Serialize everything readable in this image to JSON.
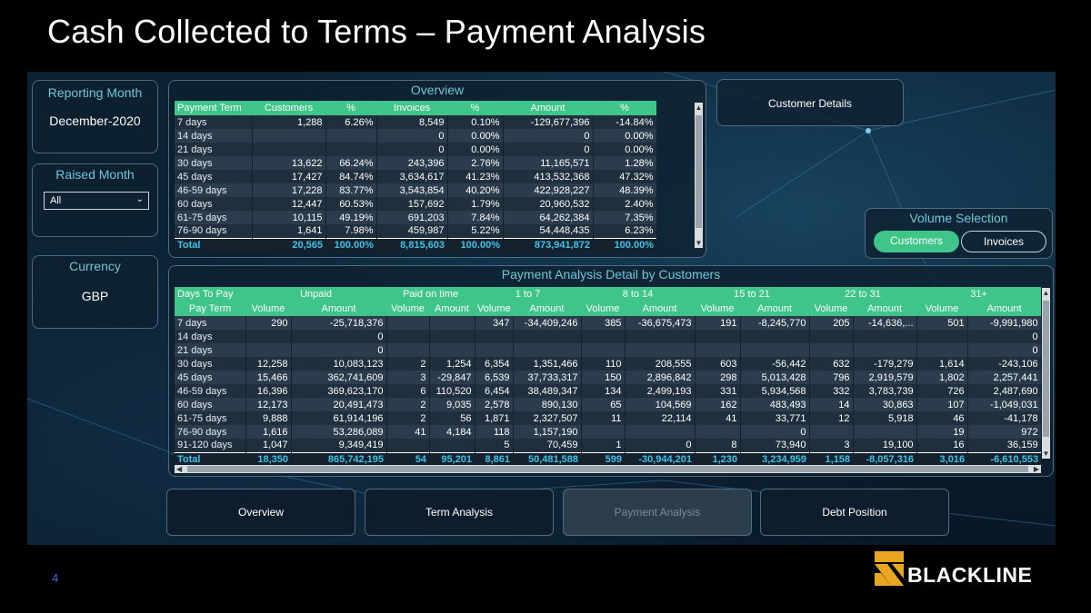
{
  "slide": {
    "title": "Cash Collected to Terms – Payment Analysis",
    "page_number": "4",
    "logo_text": "BLACKLINE"
  },
  "colors": {
    "accent_green": "#3fc58a",
    "title_teal": "#6fc6d6",
    "total_blue": "#3cc3e8",
    "brand_gold": "#e8a623"
  },
  "filters": {
    "reporting_month": {
      "label": "Reporting Month",
      "value": "December-2020"
    },
    "raised_month": {
      "label": "Raised Month",
      "selected": "All"
    },
    "currency": {
      "label": "Currency",
      "value": "GBP"
    }
  },
  "customer_details": {
    "label": "Customer Details"
  },
  "volume_selection": {
    "label": "Volume Selection",
    "options": [
      "Customers",
      "Invoices"
    ],
    "selected": "Customers"
  },
  "overview": {
    "title": "Overview",
    "columns": [
      "Payment Term",
      "Customers",
      "%",
      "Invoices",
      "%",
      "Amount",
      "%"
    ],
    "rows": [
      [
        "7 days",
        "1,288",
        "6.26%",
        "8,549",
        "0.10%",
        "-129,677,396",
        "-14.84%"
      ],
      [
        "14 days",
        "",
        "",
        "0",
        "0.00%",
        "0",
        "0.00%"
      ],
      [
        "21 days",
        "",
        "",
        "0",
        "0.00%",
        "0",
        "0.00%"
      ],
      [
        "30 days",
        "13,622",
        "66.24%",
        "243,396",
        "2.76%",
        "11,165,571",
        "1.28%"
      ],
      [
        "45 days",
        "17,427",
        "84.74%",
        "3,634,617",
        "41.23%",
        "413,532,368",
        "47.32%"
      ],
      [
        "46-59 days",
        "17,228",
        "83.77%",
        "3,543,854",
        "40.20%",
        "422,928,227",
        "48.39%"
      ],
      [
        "60 days",
        "12,447",
        "60.53%",
        "157,692",
        "1.79%",
        "20,960,532",
        "2.40%"
      ],
      [
        "61-75 days",
        "10,115",
        "49.19%",
        "691,203",
        "7.84%",
        "64,262,384",
        "7.35%"
      ],
      [
        "76-90 days",
        "1,641",
        "7.98%",
        "459,987",
        "5.22%",
        "54,448,435",
        "6.23%"
      ]
    ],
    "total": [
      "Total",
      "20,565",
      "100.00%",
      "8,815,603",
      "100.00%",
      "873,941,872",
      "100.00%"
    ]
  },
  "detail": {
    "title": "Payment Analysis Detail by Customers",
    "group_headers": [
      "Days To Pay",
      "Unpaid",
      "Paid on time",
      "1 to 7",
      "8 to 14",
      "15 to 21",
      "22 to 31",
      "31+"
    ],
    "sub_headers": [
      "Pay Term",
      "Volume",
      "Amount",
      "Volume",
      "Amount",
      "Volume",
      "Amount",
      "Volume",
      "Amount",
      "Volume",
      "Amount",
      "Volume",
      "Amount",
      "Volume",
      "Amount"
    ],
    "rows": [
      [
        "7 days",
        "290",
        "-25,718,376",
        "",
        "",
        "347",
        "-34,409,246",
        "385",
        "-36,675,473",
        "191",
        "-8,245,770",
        "205",
        "-14,636,...",
        "501",
        "-9,991,980"
      ],
      [
        "14 days",
        "",
        "0",
        "",
        "",
        "",
        "",
        "",
        "",
        "",
        "",
        "",
        "",
        "",
        "0"
      ],
      [
        "21 days",
        "",
        "0",
        "",
        "",
        "",
        "",
        "",
        "",
        "",
        "",
        "",
        "",
        "",
        "0"
      ],
      [
        "30 days",
        "12,258",
        "10,083,123",
        "2",
        "1,254",
        "6,354",
        "1,351,466",
        "110",
        "208,555",
        "603",
        "-56,442",
        "632",
        "-179,279",
        "1,614",
        "-243,106"
      ],
      [
        "45 days",
        "15,466",
        "362,741,609",
        "3",
        "-29,847",
        "6,539",
        "37,733,317",
        "150",
        "2,896,842",
        "298",
        "5,013,428",
        "796",
        "2,919,579",
        "1,802",
        "2,257,441"
      ],
      [
        "46-59 days",
        "16,396",
        "369,623,170",
        "6",
        "110,520",
        "6,454",
        "38,489,347",
        "134",
        "2,499,193",
        "331",
        "5,934,568",
        "332",
        "3,783,739",
        "726",
        "2,487,690"
      ],
      [
        "60 days",
        "12,173",
        "20,491,473",
        "2",
        "9,035",
        "2,578",
        "890,130",
        "65",
        "104,569",
        "162",
        "483,493",
        "14",
        "30,863",
        "107",
        "-1,049,031"
      ],
      [
        "61-75 days",
        "9,888",
        "61,914,196",
        "2",
        "56",
        "1,871",
        "2,327,507",
        "11",
        "22,114",
        "41",
        "33,771",
        "12",
        "5,918",
        "46",
        "-41,178"
      ],
      [
        "76-90 days",
        "1,616",
        "53,286,089",
        "41",
        "4,184",
        "118",
        "1,157,190",
        "",
        "",
        "",
        "0",
        "",
        "",
        "19",
        "972"
      ],
      [
        "91-120 days",
        "1,047",
        "9,349,419",
        "",
        "",
        "5",
        "70,459",
        "1",
        "0",
        "8",
        "73,940",
        "3",
        "19,100",
        "16",
        "36,159"
      ]
    ],
    "total": [
      "Total",
      "18,350",
      "865,742,195",
      "54",
      "95,201",
      "8,861",
      "50,481,588",
      "599",
      "-30,944,201",
      "1,230",
      "3,234,959",
      "1,158",
      "-8,057,316",
      "3,016",
      "-6,610,553"
    ]
  },
  "nav": {
    "buttons": [
      "Overview",
      "Term Analysis",
      "Payment Analysis",
      "Debt Position"
    ],
    "active": "Payment Analysis"
  }
}
